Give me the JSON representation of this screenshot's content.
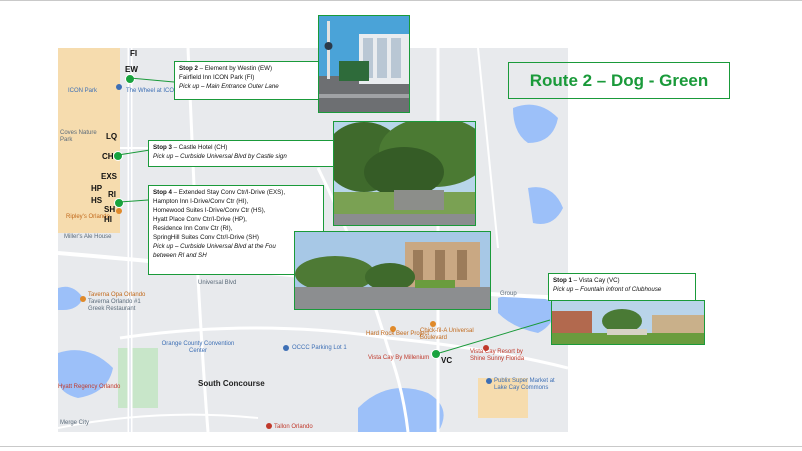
{
  "title": "Route 2 – Dog - Green",
  "map_labels": {
    "icon_park": "ICON Park",
    "wheel": "The Wheel at ICON",
    "coves": "Coves Nature Park",
    "ripleys": "Ripley's Orlando",
    "millers": "Miller's Ale House",
    "taverna": "Taverna Opa Orlando",
    "taverna_sub": "Taverna Orlando #1 Greek Restaurant",
    "universal_blvd": "Universal Blvd",
    "orange_county": "Orange County Convention Center",
    "occc_parking": "OCCC Parking Lot 1",
    "south_concourse": "South Concourse",
    "hyatt": "Hyatt Regency Orlando",
    "hard_rock": "Hard Rock Beer Project",
    "chick_fil_a": "Chick-fil-A Universal Boulevard",
    "vista_cay_millennium": "Vista Cay By Millenium",
    "vista_cay_resort": "Vista Cay Resort by Shine Sunny Florida",
    "publix": "Publix Super Market at Lake Cay Commons",
    "tallon": "Tallon Orlando",
    "lake_cay_group": "Group",
    "merge_city": "Merge City"
  },
  "stop_codes": {
    "fi": "FI",
    "ew": "EW",
    "lq": "LQ",
    "ch": "CH",
    "exs": "EXS",
    "hp": "HP",
    "ri": "RI",
    "hs": "HS",
    "sh": "SH",
    "hi": "HI",
    "vc": "VC"
  },
  "stops": [
    {
      "heading": "Stop 2",
      "name": " – Element by Westin (EW)",
      "lines": [
        "Fairfield Inn ICON Park (FI)"
      ],
      "pickup": "Pick up – Main Entrance Outer Lane"
    },
    {
      "heading": "Stop 3",
      "name": " – Castle Hotel (CH)",
      "lines": [],
      "pickup": "Pick up – Curbside Universal Blvd by Castle sign"
    },
    {
      "heading": "Stop 4",
      "name": " – Extended Stay Conv Ctr/I-Drive (EXS),",
      "lines": [
        "Hampton Inn I-Drive/Conv Ctr (HI),",
        "Homewood Suites I-Drive/Conv Ctr (HS),",
        "Hyatt Place Conv Ctr/I-Drive (HP),",
        "Residence Inn Conv Ctr (RI),",
        "SpringHill Suites Conv Ctr/I-Drive (SH)"
      ],
      "pickup": "Pick up – Curbside Universal Blvd at the Fou",
      "pickup2": "between RI and SH"
    },
    {
      "heading": "Stop 1",
      "name": " – Vista Cay (VC)",
      "lines": [],
      "pickup": "Pick up – Fountain infront of Clubhouse"
    }
  ],
  "colors": {
    "route_green": "#1a9a3a",
    "water": "#9cc0f9",
    "hotel_area": "#f6dcae",
    "park": "#c8e6c9"
  }
}
